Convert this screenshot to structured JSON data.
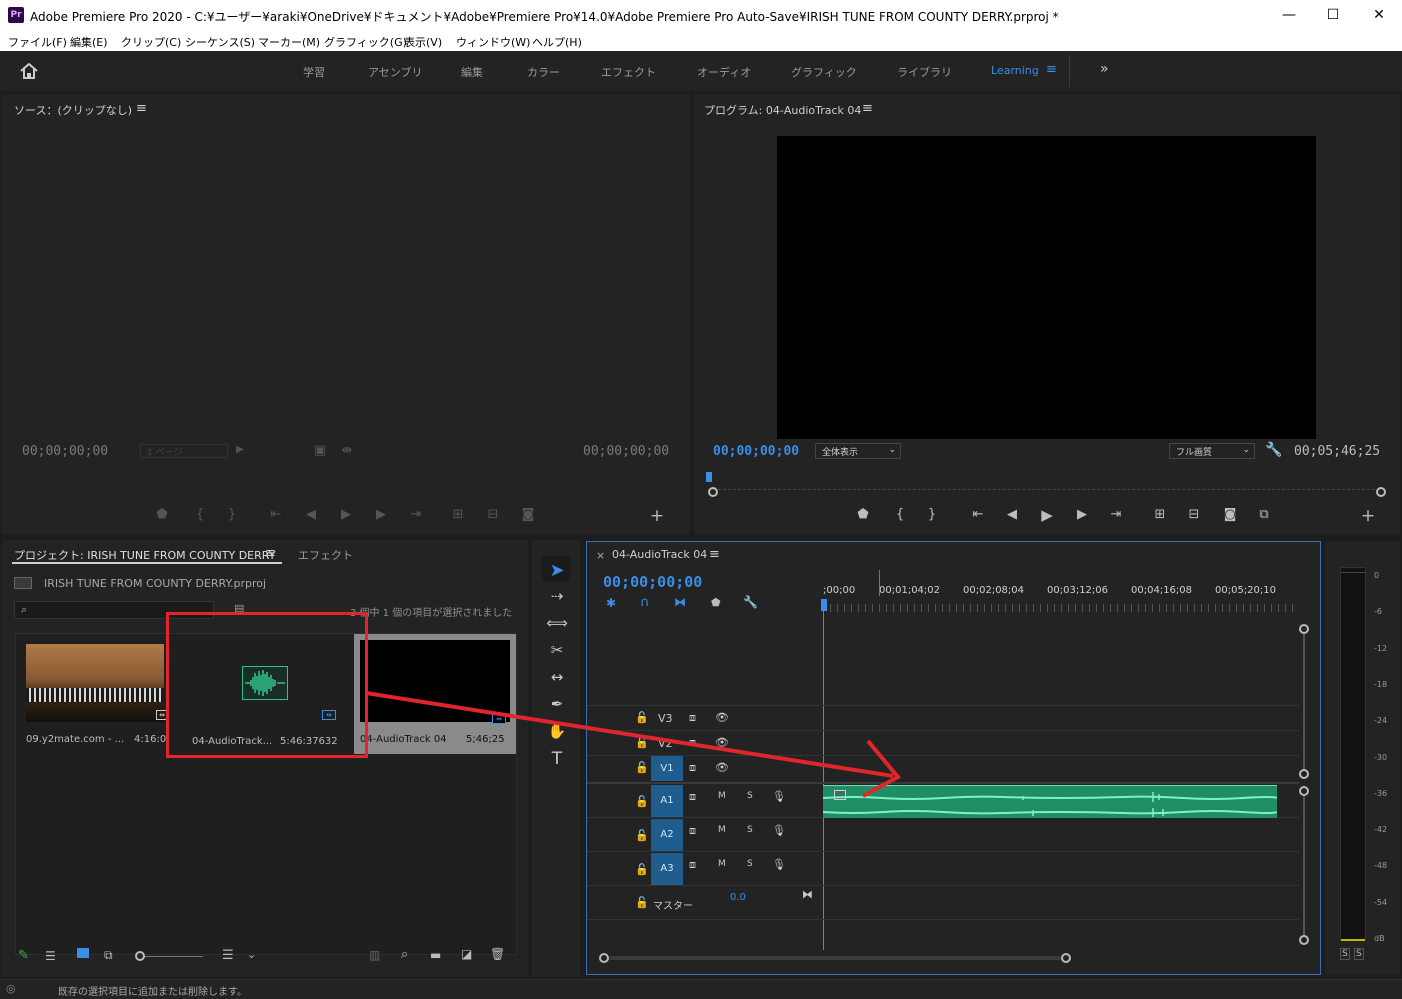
{
  "window": {
    "app_badge": "Pr",
    "title": "Adobe Premiere Pro 2020 - C:¥ユーザー¥araki¥OneDrive¥ドキュメント¥Adobe¥Premiere Pro¥14.0¥Adobe Premiere Pro Auto-Save¥IRISH TUNE FROM COUNTY DERRY.prproj *",
    "minimize": "—",
    "maximize": "☐",
    "close": "✕"
  },
  "menu": [
    "ファイル(F)",
    "編集(E)",
    "クリップ(C)",
    "シーケンス(S)",
    "マーカー(M)",
    "グラフィック(G)",
    "表示(V)",
    "ウィンドウ(W)",
    "ヘルプ(H)"
  ],
  "workspaces": [
    "学習",
    "アセンブリ",
    "編集",
    "カラー",
    "エフェクト",
    "オーディオ",
    "グラフィック",
    "ライブラリ",
    "Learning"
  ],
  "workspace_active": "Learning",
  "source_monitor": {
    "title": "ソース：(クリップなし)",
    "timecode_left": "00;00;00;00",
    "timecode_right": "00;00;00;00",
    "page_select": "1 ページ"
  },
  "program_monitor": {
    "title": "プログラム: 04-AudioTrack 04",
    "timecode_current": "00;00;00;00",
    "zoom_select": "全体表示",
    "quality_select": "フル画質",
    "duration": "00;05;46;25"
  },
  "project_panel": {
    "tab_project": "プロジェクト: IRISH TUNE FROM COUNTY DERRY",
    "tab_effects": "エフェクト",
    "file_name": "IRISH TUNE FROM COUNTY DERRY.prproj",
    "search_placeholder": "",
    "selection_status": "3 個中 1 個の項目が選択されました",
    "items": [
      {
        "name": "09.y2mate.com - ...",
        "duration": "4:16:0"
      },
      {
        "name": "04-AudioTrack...",
        "duration": "5:46:37632"
      },
      {
        "name": "04-AudioTrack 04",
        "duration": "5;46;25"
      }
    ]
  },
  "timeline": {
    "sequence_name": "04-AudioTrack 04",
    "timecode": "00;00;00;00",
    "ruler_labels": [
      ";00;00",
      "00;01;04;02",
      "00;02;08;04",
      "00;03;12;06",
      "00;04;16;08",
      "00;05;20;10"
    ],
    "video_tracks": [
      "V3",
      "V2",
      "V1"
    ],
    "audio_tracks": [
      "A1",
      "A2",
      "A3"
    ],
    "master_label": "マスター",
    "master_value": "0.0",
    "mute_label": "M",
    "solo_label": "S"
  },
  "audio_meter": {
    "ticks": [
      "0",
      "-6",
      "-12",
      "-18",
      "-24",
      "-30",
      "-36",
      "-42",
      "-48",
      "-54",
      "dB"
    ],
    "solo_left": "S",
    "solo_right": "S"
  },
  "status_bar": {
    "message": "既存の選択項目に追加または削除します。"
  },
  "annotation_colors": {
    "highlight": "#e0262b",
    "waveform": "#2fbf8a"
  }
}
